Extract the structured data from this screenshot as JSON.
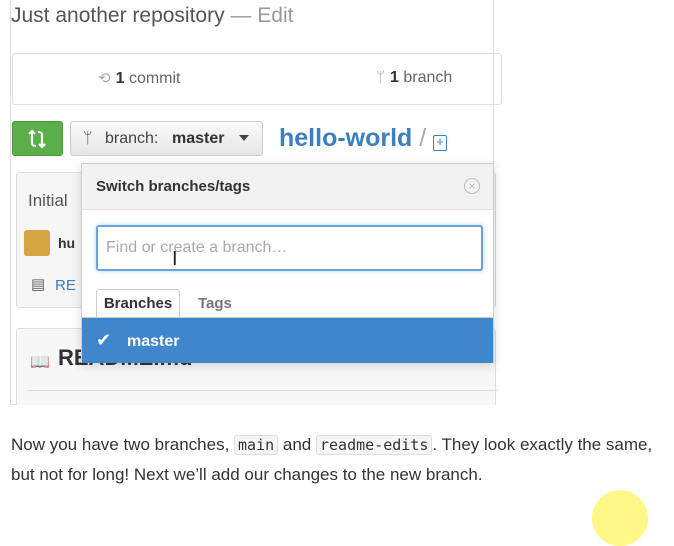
{
  "repo": {
    "description": "Just another repository",
    "edit_label": "— Edit",
    "name": "hello-world",
    "separator": "/"
  },
  "stats": {
    "commits": {
      "count": "1",
      "label": "commit",
      "icon": "history-icon"
    },
    "branches": {
      "count": "1",
      "label": "branch",
      "icon": "branch-icon"
    }
  },
  "branch_button": {
    "prefix": "branch:",
    "current": "master"
  },
  "background": {
    "commit_message": "Initial",
    "author": "hu",
    "file": "RE",
    "readme_title": "README.md"
  },
  "dropdown": {
    "title": "Switch branches/tags",
    "input_placeholder": "Find or create a branch…",
    "tabs": [
      {
        "label": "Branches",
        "selected": true
      },
      {
        "label": "Tags",
        "selected": false
      }
    ],
    "items": [
      {
        "label": "master",
        "checked": true
      }
    ]
  },
  "paragraph": {
    "part1": "Now you have two branches,",
    "code1": "main",
    "part2": "and",
    "code2": "readme-edits",
    "part3": ". They look exactly the same, but not for long! Next we’ll add our changes to the new branch."
  },
  "colors": {
    "accent": "#3e7fc1",
    "selected": "#3f86cc",
    "compare_green": "#5cae4b"
  }
}
